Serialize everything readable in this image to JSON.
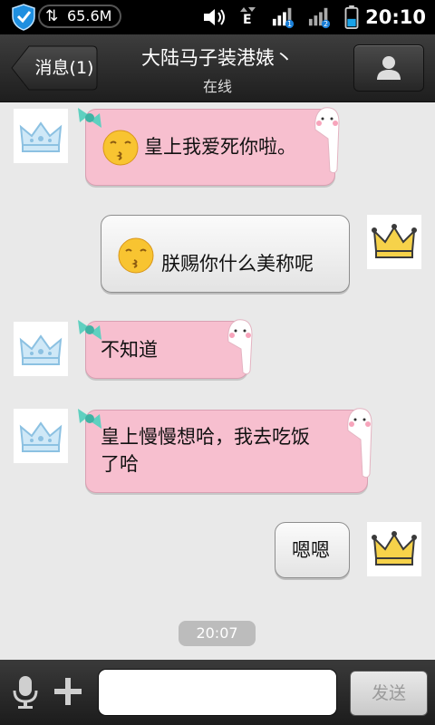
{
  "status_bar": {
    "memory": "65.6M",
    "time": "20:10",
    "network_label": "E",
    "sim1_badge": "1",
    "sim2_badge": "2"
  },
  "header": {
    "back_label": "消息(1)",
    "title": "大陆马子装港婊丶",
    "status": "在线"
  },
  "messages": [
    {
      "direction": "incoming",
      "text": "皇上我爱死你啦。",
      "emoji": "kiss-emoji"
    },
    {
      "direction": "outgoing",
      "text": "朕赐你什么美称呢",
      "emoji": "kiss-emoji"
    },
    {
      "direction": "incoming",
      "text": "不知道"
    },
    {
      "direction": "incoming",
      "text_line1": "皇上慢慢想哈，我去吃饭",
      "text_line2": "了哈"
    },
    {
      "direction": "outgoing",
      "text": "嗯嗯"
    }
  ],
  "timestamp": "20:07",
  "input_bar": {
    "send_label": "发送",
    "input_value": ""
  },
  "colors": {
    "incoming_bubble": "#f7bfcf",
    "outgoing_bubble": "#eeeeee",
    "chat_background": "#e9e9e9"
  }
}
